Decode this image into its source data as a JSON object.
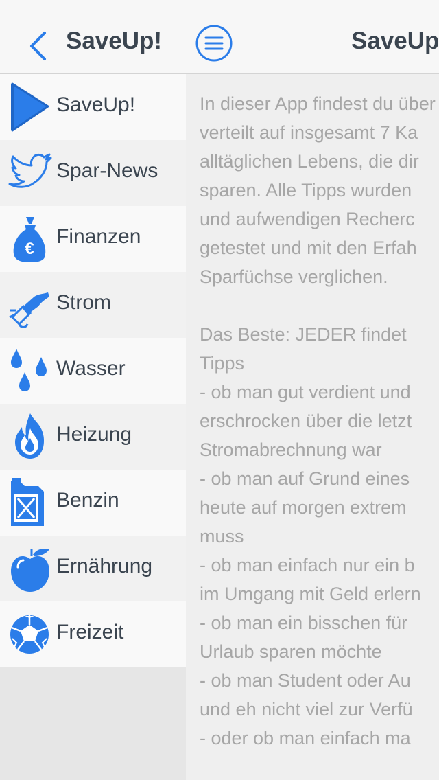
{
  "colors": {
    "accent": "#2b7de9",
    "text": "#3b4550",
    "body_text": "#a6a6a6"
  },
  "sidebar": {
    "title": "SaveUp!",
    "back_icon": "chevron-left-icon",
    "items": [
      {
        "label": "SaveUp!",
        "icon": "play-icon"
      },
      {
        "label": "Spar-News",
        "icon": "bird-icon"
      },
      {
        "label": "Finanzen",
        "icon": "money-bag-icon"
      },
      {
        "label": "Strom",
        "icon": "plug-icon"
      },
      {
        "label": "Wasser",
        "icon": "water-drops-icon"
      },
      {
        "label": "Heizung",
        "icon": "flame-icon"
      },
      {
        "label": "Benzin",
        "icon": "fuel-can-icon"
      },
      {
        "label": "Ernährung",
        "icon": "apple-icon"
      },
      {
        "label": "Freizeit",
        "icon": "soccer-ball-icon"
      }
    ]
  },
  "main": {
    "title": "SaveUp!",
    "menu_icon": "hamburger-menu-icon",
    "lines": [
      "In dieser App findest du über",
      "verteilt auf insgesamt 7 Ka",
      "alltäglichen Lebens, die dir",
      "sparen. Alle Tipps wurden",
      "und aufwendigen Recherc",
      "getestet und mit den Erfah",
      "Sparfüchse verglichen.",
      "",
      "Das Beste: JEDER findet",
      "Tipps",
      "- ob man gut verdient und",
      "erschrocken über die letzt",
      "Stromabrechnung war",
      "- ob man auf Grund eines",
      "heute auf morgen extrem",
      "muss",
      "- ob man einfach nur ein b",
      "im Umgang mit Geld erlern",
      "- ob man ein bisschen für",
      "Urlaub sparen möchte",
      "- ob man Student oder Au",
      "und eh nicht viel zur Verfü",
      "- oder ob man einfach ma"
    ]
  }
}
